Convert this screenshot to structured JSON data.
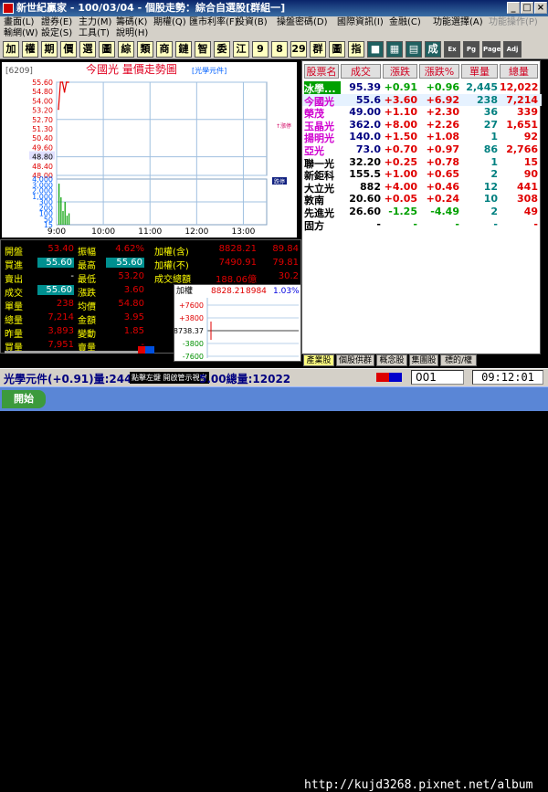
{
  "window": {
    "title": "新世紀贏家 - 100/03/04 - 個股走勢：綜合自選股[群組一]",
    "min": "_",
    "max": "□",
    "close": "×"
  },
  "menu1": [
    {
      "label": "畫面(L)",
      "disabled": false
    },
    {
      "label": "證券(E)",
      "disabled": false
    },
    {
      "label": "主力(M)",
      "disabled": false
    },
    {
      "label": "籌碼(K)",
      "disabled": false
    },
    {
      "label": "期權(Q)",
      "disabled": false
    },
    {
      "label": "匯市利率(F)",
      "disabled": false
    },
    {
      "label": "投資(B)",
      "disabled": false
    },
    {
      "label": "操盤密碼(D)",
      "disabled": false
    },
    {
      "label": "國際資訊(I)",
      "disabled": false
    },
    {
      "label": "金融(C)",
      "disabled": false
    },
    {
      "label": "功能選擇(A)",
      "disabled": false
    },
    {
      "label": "功能操作(P)",
      "disabled": true
    }
  ],
  "menu2": [
    {
      "label": "輸網(W)"
    },
    {
      "label": "設定(S)"
    },
    {
      "label": "工具(T)"
    },
    {
      "label": "說明(H)"
    }
  ],
  "toolbar": [
    "加",
    "權",
    "期",
    "價",
    "選",
    "圖",
    "綜",
    "類",
    "商",
    "鏈",
    "智",
    "委",
    "江",
    "9",
    "8",
    "29",
    "群",
    "圖",
    "指",
    "■",
    "▦",
    "▤",
    "成",
    "Ex",
    "Pg",
    "Page",
    "Adj"
  ],
  "chart": {
    "code": "6209",
    "title": "今國光 量價走勢圖",
    "source_label": "[光學元件]",
    "limit_up_label": "↑漲停",
    "limit_down_label": "跌停",
    "price_ticks": [
      "55.60",
      "54.80",
      "54.00",
      "53.20",
      "52.70",
      "51.30",
      "50.40",
      "49.60",
      "48.80",
      "48.40",
      "48.00"
    ],
    "vol_ticks": [
      "4,000",
      "3,000",
      "2,000",
      "1,000",
      "300",
      "200",
      "100",
      "50",
      "15"
    ],
    "time_ticks": [
      "9:00",
      "10:00",
      "11:00",
      "12:00",
      "13:00"
    ]
  },
  "chart_data": {
    "type": "line",
    "title": "今國光 量價走勢圖",
    "x": [
      "9:00",
      "9:03",
      "9:06",
      "9:09",
      "9:12",
      "9:15"
    ],
    "series": [
      {
        "name": "今國光",
        "values": [
          53.4,
          55.6,
          55.6,
          54.8,
          55.6,
          55.6
        ]
      }
    ],
    "ylim": [
      48.0,
      55.6
    ]
  },
  "quote": {
    "open_label": "開盤",
    "open": "53.40",
    "amp_label": "振幅",
    "amp": "4.62%",
    "buy_label": "買進",
    "buy": "55.60",
    "high_label": "最高",
    "high": "55.60",
    "sell_label": "賣出",
    "sell": "-",
    "low_label": "最低",
    "low": "53.20",
    "deal_label": "成交",
    "deal": "55.60",
    "chg_label": "漲跌",
    "chg": "3.60",
    "vol_label": "單量",
    "vol": "238",
    "avg_label": "均價",
    "avg": "54.80",
    "total_label": "總量",
    "total": "7,214",
    "amt_label": "金額",
    "amt": "3.95",
    "yest_label": "昨量",
    "yest": "3,893",
    "chg2_label": "變動",
    "chg2": "1.85",
    "buyv_label": "買量",
    "buyv": "7,951",
    "sellv_label": "賣量",
    "sellv": "-",
    "idx_inc_label": "加權(含)",
    "idx_inc": "8828.21",
    "idx_inc_r": "89.84",
    "idx_ex_label": "加權(不)",
    "idx_ex": "7490.91",
    "idx_ex_r": "79.81",
    "turnover_label": "成交總額",
    "turnover": "188.06億",
    "turnover_r": "30.2"
  },
  "mini": {
    "label": "加權",
    "val1": "8828.21",
    "val2": "8984",
    "pct": "1.03%",
    "ticks": [
      "+7600",
      "+3800",
      "8738.37",
      "-3800",
      "-7600"
    ]
  },
  "table": {
    "headers": [
      "股票名",
      "成交",
      "漲跌",
      "漲跌%",
      "單量",
      "總量"
    ],
    "rows": [
      {
        "name": "冰學...",
        "price": "95.39",
        "chg": "+0.91",
        "pct": "+0.96",
        "vol": "2,445",
        "total": "12,022",
        "color": "#00a000"
      },
      {
        "name": "今國光",
        "price": "55.6",
        "chg": "+3.60",
        "pct": "+6.92",
        "vol": "238",
        "total": "7,214",
        "color": "#e00000",
        "hl": true
      },
      {
        "name": "榮茂",
        "price": "49.00",
        "chg": "+1.10",
        "pct": "+2.30",
        "vol": "36",
        "total": "339",
        "color": "#e00000"
      },
      {
        "name": "玉晶光",
        "price": "362.0",
        "chg": "+8.00",
        "pct": "+2.26",
        "vol": "27",
        "total": "1,651",
        "color": "#e00000"
      },
      {
        "name": "揚明光",
        "price": "140.0",
        "chg": "+1.50",
        "pct": "+1.08",
        "vol": "1",
        "total": "92",
        "color": "#e00000"
      },
      {
        "name": "亞光",
        "price": "73.0",
        "chg": "+0.70",
        "pct": "+0.97",
        "vol": "86",
        "total": "2,766",
        "color": "#e00000"
      },
      {
        "name": "聯一光",
        "price": "32.20",
        "chg": "+0.25",
        "pct": "+0.78",
        "vol": "1",
        "total": "15",
        "color": "#e00000"
      },
      {
        "name": "新鉅科",
        "price": "155.5",
        "chg": "+1.00",
        "pct": "+0.65",
        "vol": "2",
        "total": "90",
        "color": "#e00000"
      },
      {
        "name": "大立光",
        "price": "882",
        "chg": "+4.00",
        "pct": "+0.46",
        "vol": "12",
        "total": "441",
        "color": "#e00000"
      },
      {
        "name": "敦南",
        "price": "20.60",
        "chg": "+0.05",
        "pct": "+0.24",
        "vol": "10",
        "total": "308",
        "color": "#e00000"
      },
      {
        "name": "先進光",
        "price": "26.60",
        "chg": "-1.25",
        "pct": "-4.49",
        "vol": "2",
        "total": "49",
        "color": "#00a000"
      },
      {
        "name": "固方",
        "price": "-",
        "chg": "-",
        "pct": "-",
        "vol": "-",
        "total": "-",
        "color": "#00a000"
      }
    ]
  },
  "tabs": [
    {
      "label": "產業股",
      "active": true
    },
    {
      "label": "個股供群",
      "active": false
    },
    {
      "label": "概念股",
      "active": false
    },
    {
      "label": "集團股",
      "active": false
    },
    {
      "label": "標的/權證",
      "active": false
    }
  ],
  "status": {
    "ticker": "光學元件(+0.91)量:244",
    "tip": "點擊左鍵 開啟管示視窗",
    "ticker2": "5.00總量:12022",
    "code": "001",
    "time": "09:12:01"
  },
  "taskbar": {
    "start": "開始",
    "watermark": "http://kujd3268.pixnet.net/album"
  }
}
